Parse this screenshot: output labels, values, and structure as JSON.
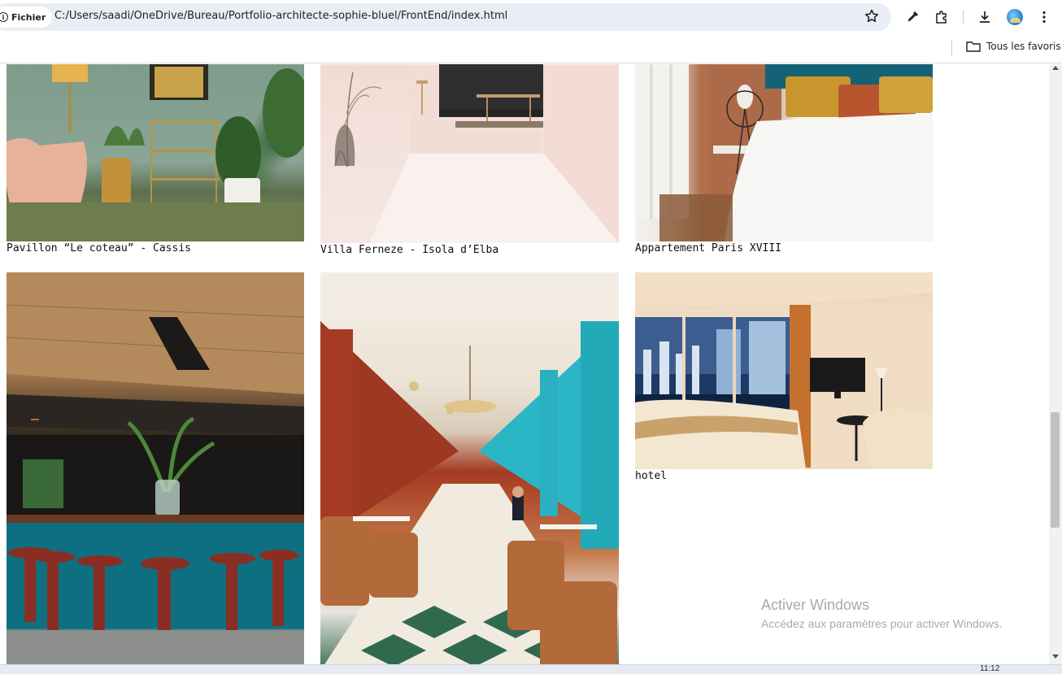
{
  "browser": {
    "site_chip_label": "Fichier",
    "url": "C:/Users/saadi/OneDrive/Bureau/Portfolio-architecte-sophie-bluel/FrontEnd/index.html",
    "all_favorites_label": "Tous les favoris",
    "icons": [
      "info-icon",
      "star-icon",
      "eyedropper-icon",
      "extensions-icon",
      "download-icon",
      "profile-avatar",
      "more-menu-icon",
      "folder-icon"
    ]
  },
  "gallery": {
    "items": [
      {
        "caption": "Pavillon “Le coteau” - Cassis"
      },
      {
        "caption": "Villa Ferneze - Isola d’Elba"
      },
      {
        "caption": "Appartement Paris XVIII"
      },
      {
        "caption": ""
      },
      {
        "caption": ""
      },
      {
        "caption": "hotel"
      }
    ]
  },
  "watermark": {
    "title": "Activer Windows",
    "subtitle": "Accédez aux paramètres pour activer Windows."
  },
  "taskbar": {
    "clock": "11:12"
  }
}
